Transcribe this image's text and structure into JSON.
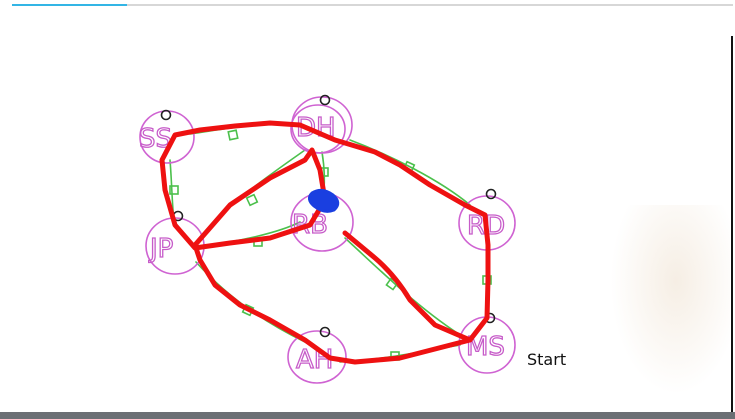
{
  "video_progress_percent": 16,
  "start_label": "Start",
  "nodes": [
    {
      "id": "SS",
      "label": "SS"
    },
    {
      "id": "DH",
      "label": "DH"
    },
    {
      "id": "RD",
      "label": "RD"
    },
    {
      "id": "JP",
      "label": "JP"
    },
    {
      "id": "RB",
      "label": "RB"
    },
    {
      "id": "MS",
      "label": "MS"
    },
    {
      "id": "AH",
      "label": "AH"
    }
  ],
  "colors": {
    "node": "#cf63d2",
    "edge": "#4cc04c",
    "path": "#ee1111",
    "current": "#1a3fe0",
    "progress": "#33b5e5"
  }
}
